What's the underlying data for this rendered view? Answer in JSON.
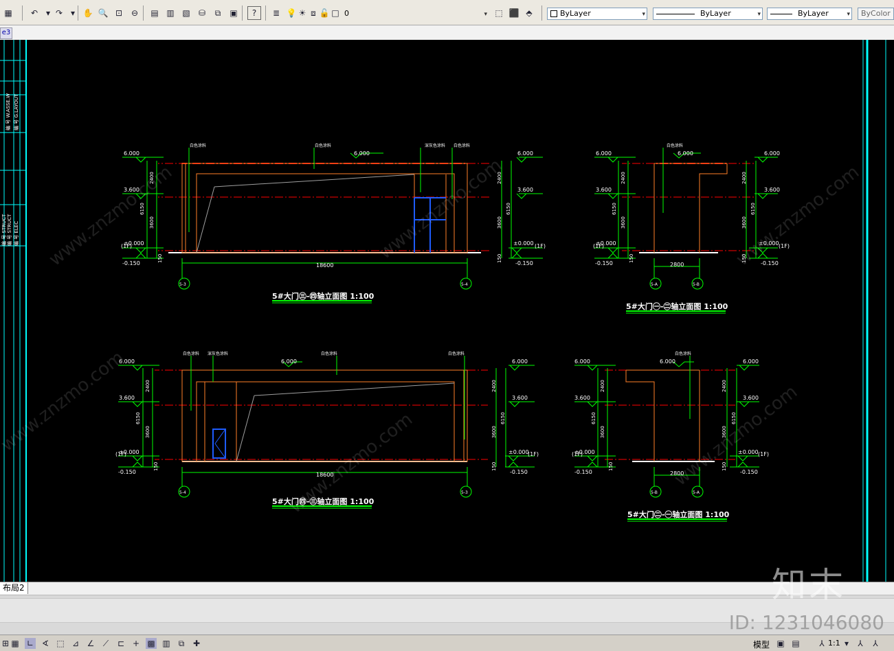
{
  "toolbar": {
    "layer_value": "0",
    "color_value": "ByLayer",
    "linetype_value": "ByLayer",
    "lineweight_value": "ByLayer",
    "plotstyle_value": "ByColor"
  },
  "file_tab": {
    "label": "e3"
  },
  "side_strip_texts": [
    "编 号 W.ASSE.W",
    "编 号 G.LAYOUT",
    "编 号 STRUCT",
    "编 号 STRUCT",
    "编 号 ELEC"
  ],
  "drawings": {
    "d1": {
      "title": "5#大门㊂-㊃轴立面图 1:100",
      "levels": [
        "6.000",
        "3.600",
        "±0.000",
        "-0.150"
      ],
      "levels_right": [
        "6.000",
        "3.600",
        "±0.000",
        "-0.150"
      ],
      "dims": [
        "2400",
        "6150",
        "3600",
        "150"
      ],
      "span": "18600",
      "axes": [
        "5-3",
        "5-4"
      ],
      "floor_left": "(1F)",
      "floor_right": "(1F)",
      "top_mid_level": "6.000",
      "notes": [
        "白色涂料",
        "白色涂料",
        "深灰色涂料",
        "白色涂料"
      ]
    },
    "d2": {
      "title": "5#大门㊀-㊁轴立面图 1:100",
      "levels": [
        "6.000",
        "3.600",
        "±0.000",
        "-0.150"
      ],
      "levels_right": [
        "6.000",
        "3.600",
        "±0.000",
        "-0.150"
      ],
      "dims": [
        "2400",
        "6150",
        "3600",
        "150"
      ],
      "span": "2800",
      "axes": [
        "5-A",
        "5-B"
      ],
      "floor_left": "(1F)",
      "floor_right": "(1F)",
      "top_mid_level": "6.000",
      "notes": [
        "白色涂料"
      ]
    },
    "d3": {
      "title": "5#大门㊃-㊂轴立面图 1:100",
      "levels": [
        "6.000",
        "3.600",
        "±0.000",
        "-0.150"
      ],
      "levels_right": [
        "6.000",
        "3.600",
        "±0.000",
        "-0.150"
      ],
      "dims": [
        "2400",
        "6150",
        "3600",
        "150"
      ],
      "span": "18600",
      "axes": [
        "5-4",
        "5-3"
      ],
      "floor_left": "(1F)",
      "floor_right": "(1F)",
      "top_mid_level": "6.000",
      "notes": [
        "白色涂料",
        "深灰色涂料",
        "白色涂料",
        "白色涂料"
      ]
    },
    "d4": {
      "title": "5#大门㊁-㊀轴立面图 1:100",
      "levels": [
        "6.000",
        "3.600",
        "±0.000",
        "-0.150"
      ],
      "levels_right": [
        "6.000",
        "3.600",
        "±0.000",
        "-0.150"
      ],
      "dims": [
        "2400",
        "6150",
        "3600",
        "150"
      ],
      "span": "2800",
      "axes": [
        "5-B",
        "5-A"
      ],
      "floor_left": "(1F)",
      "floor_right": "(1F)",
      "top_mid_level": "6.000",
      "notes": [
        "白色涂料"
      ]
    }
  },
  "layout_tab": {
    "label": "布局2"
  },
  "status": {
    "model_label": "模型",
    "scale_label": "1:1"
  },
  "watermark": {
    "brand": "知末",
    "id_text": "ID: 1231046080",
    "site_text": "www.znzmo.com"
  },
  "colors": {
    "canvas_bg": "#000000",
    "cyan_frame": "#00ffff",
    "dim_green": "#00ff00",
    "orange_line": "#ff7f27",
    "red_dash": "#ff0000",
    "blue_window": "#1e5cff",
    "grey_slope": "#a0a0a0"
  }
}
